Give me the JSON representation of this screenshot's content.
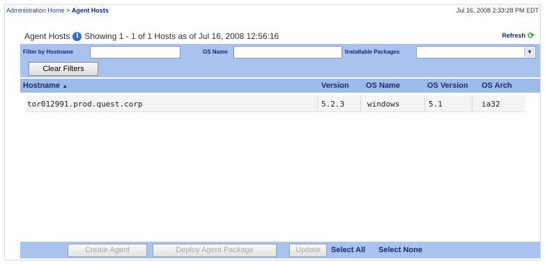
{
  "breadcrumb": {
    "home": "Administration Home",
    "separator": ">",
    "current": "Agent Hosts"
  },
  "timestamp": "Jul 16, 2008 2:33:28 PM EDT",
  "panel": {
    "title": "Agent Hosts",
    "info_icon": "i",
    "showing_text": "Showing 1 - 1  of 1 Hosts as of Jul 16, 2008 12:56:16",
    "refresh_label": "Refresh",
    "refresh_icon": "⟳"
  },
  "filters": {
    "hostname_label": "Filter by Hostname",
    "hostname_value": "",
    "osname_label": "OS Name",
    "osname_value": "",
    "packages_label": "Installable Packages",
    "packages_selected": "",
    "clear_label": "Clear Filters"
  },
  "table": {
    "columns": {
      "hostname": "Hostname",
      "version": "Version",
      "os_name": "OS Name",
      "os_version": "OS Version",
      "os_arch": "OS Arch"
    },
    "sort_icon": "▲",
    "rows": [
      {
        "hostname": "tor012991.prod.quest.corp",
        "version": "5.2.3",
        "os_name": "windows",
        "os_version": "5.1",
        "os_arch": "ia32"
      }
    ]
  },
  "footer": {
    "create_agent": "Create Agent",
    "deploy_package": "Deploy Agent Package",
    "update": "Update",
    "select_all": "Select All",
    "select_none": "Select None"
  },
  "colors": {
    "accent_bar": "#a9c3ee",
    "header_bar": "#9ebbe8",
    "link_text": "#1a2a6e"
  }
}
